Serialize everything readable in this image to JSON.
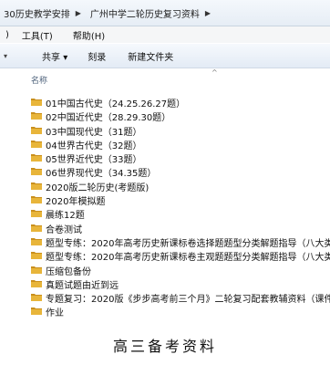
{
  "breadcrumb": {
    "segments": [
      "30历史教学安排",
      "广州中学二轮历史复习资料"
    ]
  },
  "menubar": {
    "items": [
      ")",
      "工具(T)",
      "帮助(H)"
    ]
  },
  "toolbar": {
    "share_label": "共享 ▾",
    "burn_label": "刻录",
    "new_folder_label": "新建文件夹"
  },
  "columns": {
    "name_label": "名称"
  },
  "files": [
    "01中国古代史（24.25.26.27题）",
    "02中国近代史（28.29.30题）",
    "03中国现代史（31题）",
    "04世界古代史（32题）",
    "05世界近代史（33题）",
    "06世界现代史（34.35题）",
    "2020版二轮历史(考题版)",
    "2020年模拟题",
    "晨练12题",
    "合卷测试",
    "题型专练：2020年高考历史新课标卷选择题题型分类解题指导（八大类）",
    "题型专练：2020年高考历史新课标卷主观题题型分类解题指导（八大类）",
    "压缩包备份",
    "真题试题由近到远",
    "专题复习：2020版《步步高考前三个月》二轮复习配套教辅资料（课件+讲",
    "作业"
  ],
  "caption": "高三备考资料",
  "icons": {
    "folder": "folder-icon",
    "separator": "chevron-right-icon",
    "sort": "sort-caret-icon"
  },
  "colors": {
    "folder": "#e8b53a",
    "folder_dark": "#c98f1c",
    "bar_top": "#f4f8fc",
    "bar_bottom": "#e6edf5"
  }
}
